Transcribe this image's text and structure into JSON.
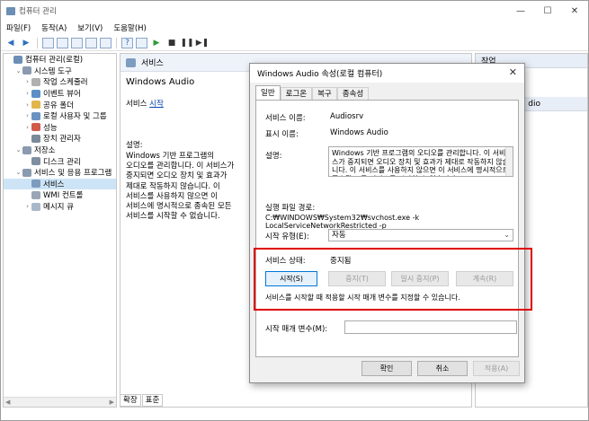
{
  "window": {
    "title": "컴퓨터 관리",
    "controls": [
      "—",
      "☐",
      "✕"
    ]
  },
  "menu": [
    "파일(F)",
    "동작(A)",
    "보기(V)",
    "도움말(H)"
  ],
  "tree": {
    "items": [
      {
        "label": "컴퓨터 관리(로컬)",
        "arrow": "",
        "indent": 0,
        "color": "#6b8fb5",
        "selected": false
      },
      {
        "label": "시스템 도구",
        "arrow": "⌄",
        "indent": 1,
        "color": "#8a9bb0",
        "selected": false
      },
      {
        "label": "작업 스케줄러",
        "arrow": "›",
        "indent": 2,
        "color": "#b0b0b0",
        "selected": false
      },
      {
        "label": "이벤트 뷰어",
        "arrow": "›",
        "indent": 2,
        "color": "#5c8fc5",
        "selected": false
      },
      {
        "label": "공유 폴더",
        "arrow": "›",
        "indent": 2,
        "color": "#e2b54a",
        "selected": false
      },
      {
        "label": "로컬 사용자 및 그룹",
        "arrow": "›",
        "indent": 2,
        "color": "#6a92c2",
        "selected": false
      },
      {
        "label": "성능",
        "arrow": "›",
        "indent": 2,
        "color": "#d25a4a",
        "selected": false
      },
      {
        "label": "장치 관리자",
        "arrow": "",
        "indent": 2,
        "color": "#7a8a9a",
        "selected": false
      },
      {
        "label": "저장소",
        "arrow": "⌄",
        "indent": 1,
        "color": "#8a9bb0",
        "selected": false
      },
      {
        "label": "디스크 관리",
        "arrow": "",
        "indent": 2,
        "color": "#7f8ea0",
        "selected": false
      },
      {
        "label": "서비스 및 응용 프로그램",
        "arrow": "⌄",
        "indent": 1,
        "color": "#8a9bb0",
        "selected": false
      },
      {
        "label": "서비스",
        "arrow": "",
        "indent": 2,
        "color": "#7d9cc0",
        "selected": true
      },
      {
        "label": "WMI 컨트롤",
        "arrow": "",
        "indent": 2,
        "color": "#9aa5b5",
        "selected": false
      },
      {
        "label": "메시지 큐",
        "arrow": "›",
        "indent": 2,
        "color": "#a8b8c8",
        "selected": false
      }
    ]
  },
  "middle": {
    "header": "서비스",
    "service_name": "Windows Audio",
    "start_prefix": "서비스 ",
    "start_link": "시작",
    "desc_label": "설명:",
    "description": "Windows 기반 프로그램의 오디오를 관리합니다. 이 서비스가 중지되면 오디오 장치 및 효과가 제대로 작동하지 않습니다. 이 서비스를 사용하지 않으면 이 서비스에 명시적으로 종속된 모든 서비스를 시작할 수 없습니다.",
    "tabs": [
      "확장",
      "표준"
    ]
  },
  "actions": {
    "header": "작업",
    "partial": "dio"
  },
  "dialog": {
    "title": "Windows Audio 속성(로컬 컴퓨터)",
    "tabs": [
      "일반",
      "로그온",
      "복구",
      "종속성"
    ],
    "service_name_label": "서비스 이름:",
    "service_name_value": "Audiosrv",
    "display_name_label": "표시 이름:",
    "display_name_value": "Windows Audio",
    "desc_label": "설명:",
    "desc_value": "Windows 기반 프로그램의 오디오를 관리합니다. 이 서비스가 중지되면 오디오 장치 및 효과가 제대로 작동하지 않습니다. 이 서비스를 사용하지 않으면 이 서비스에 명시적으로 종속된 모든 서비스를 시작할 수 없습니다.",
    "path_label": "실행 파일 경로:",
    "path_value": "C:₩WINDOWS₩System32₩svchost.exe -k LocalServiceNetworkRestricted -p",
    "startup_label": "시작 유형(E):",
    "startup_value": "자동",
    "status_label": "서비스 상태:",
    "status_value": "중지됨",
    "start_btn": "시작(S)",
    "stop_btn": "중지(T)",
    "pause_btn": "일시 중지(P)",
    "resume_btn": "계속(R)",
    "hint": "서비스를 시작할 때 적용할 시작 매개 변수를 지정할 수 있습니다.",
    "param_label": "시작 매개 변수(M):",
    "param_value": "",
    "ok_btn": "확인",
    "cancel_btn": "취소",
    "apply_btn": "적용(A)"
  },
  "colors": {
    "highlight_box": "#e00000",
    "selected_tree": "#cde4f7"
  }
}
